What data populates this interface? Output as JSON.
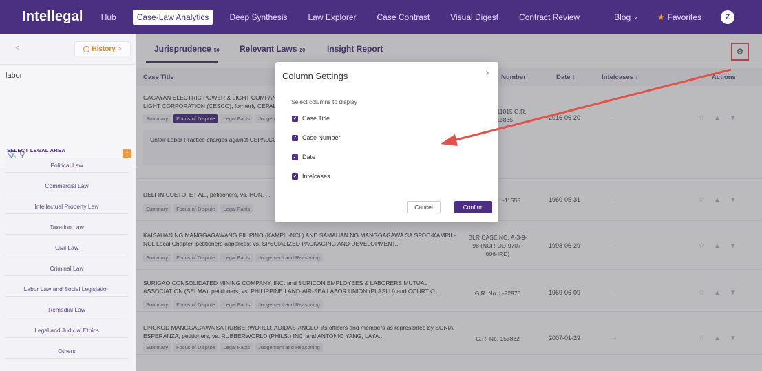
{
  "nav": {
    "brand": "Intellegal",
    "items": [
      {
        "label": "Hub"
      },
      {
        "label": "Case-Law Analytics"
      },
      {
        "label": "Deep Synthesis"
      },
      {
        "label": "Law Explorer"
      },
      {
        "label": "Case Contrast"
      },
      {
        "label": "Visual Digest"
      },
      {
        "label": "Contract Review"
      }
    ],
    "blog": "Blog",
    "favorites": "Favorites",
    "avatar": "Z"
  },
  "sidebar": {
    "back": "<",
    "history": "History",
    "history_chevron": ">",
    "query": "labor",
    "area_title": "SELECT LEGAL AREA",
    "areas": [
      "Political Law",
      "Commercial Law",
      "Intellectual Property Law",
      "Taxation Law",
      "Civil Law",
      "Criminal Law",
      "Labor Law and Social Legislation",
      "Remedial Law",
      "Legal and Judicial Ethics",
      "Others"
    ]
  },
  "tabs": [
    {
      "label": "Jurisprudence",
      "count": "50"
    },
    {
      "label": "Relevant Laws",
      "count": "20"
    },
    {
      "label": "Insight Report",
      "count": ""
    }
  ],
  "table": {
    "headers": {
      "title": "Case Title",
      "number": "Number",
      "date": "Date ↕",
      "intelcases": "Intelcases ↕",
      "actions": "Actions"
    },
    "sub_tabs": [
      "Summary",
      "Focus of Dispute",
      "Legal Facts",
      "Judgement and Reasoning"
    ],
    "rows": [
      {
        "title": "CAGAYAN ELECTRIC POWER & LIGHT COMPANY, INC. (CEPALCO), petitioner, vs. CAGAYAN ELECTRIC POWER & LIGHT CORPORATION (CESCO), formerly CEPALCO",
        "number": "G.R. No. 211015 G.R. No. 213835",
        "date": "2016-06-20",
        "intelcases": "-",
        "summary": "Unfair Labor Practice charges against CEPALCO and CESCO, allegedly engaging in labor-only contracting agreements"
      },
      {
        "title": "DELFIN CUETO, ET AL., petitioners, vs. HON. ...",
        "number": "G.R. No. L-11555",
        "date": "1960-05-31",
        "intelcases": "-"
      },
      {
        "title": "KAISAHAN NG MANGGAGAWANG PILIPINO (KAMPIL-NCL) AND SAMAHAN NG MANGGAGAWA SA SPDC-KAMPIL-NCL Local Chapter, petitioners-appellees; vs. SPECIALIZED PACKAGING AND DEVELOPMENT...",
        "number": "BLR CASE NO. A-3-9-98 (NCR-OD-9707-006-IRD)",
        "date": "1998-06-29",
        "intelcases": "-"
      },
      {
        "title": "SURIGAO CONSOLIDATED MINING COMPANY, INC. and SURICON EMPLOYEES & LABORERS MUTUAL ASSOCIATION (SELMA), petitioners, vs. PHILIPPINE LAND-AIR-SEA LABOR UNION (PLASLU) and COURT O...",
        "number": "G.R. No. L-22970",
        "date": "1969-06-09",
        "intelcases": "-"
      },
      {
        "title": "LINGKOD MANGGAGAWA SA RUBBERWORLD, ADIDAS-ANGLO, its officers and members as represented by SONIA ESPERANZA, petitioners, vs. RUBBERWORLD (PHILS.) INC. and ANTONIO YANG, LAYA...",
        "number": "G.R. No. 153882",
        "date": "2007-01-29",
        "intelcases": "-"
      }
    ]
  },
  "modal": {
    "title": "Column Settings",
    "close": "×",
    "hint": "Select columns to display",
    "options": [
      {
        "label": "Case Title",
        "checked": true
      },
      {
        "label": "Case Number",
        "checked": true
      },
      {
        "label": "Date",
        "checked": true
      },
      {
        "label": "Intelcases",
        "checked": true
      }
    ],
    "cancel": "Cancel",
    "confirm": "Confirm"
  },
  "colors": {
    "brand": "#4b2f80",
    "accent": "#e58a2d",
    "annotation": "#e0534b"
  }
}
